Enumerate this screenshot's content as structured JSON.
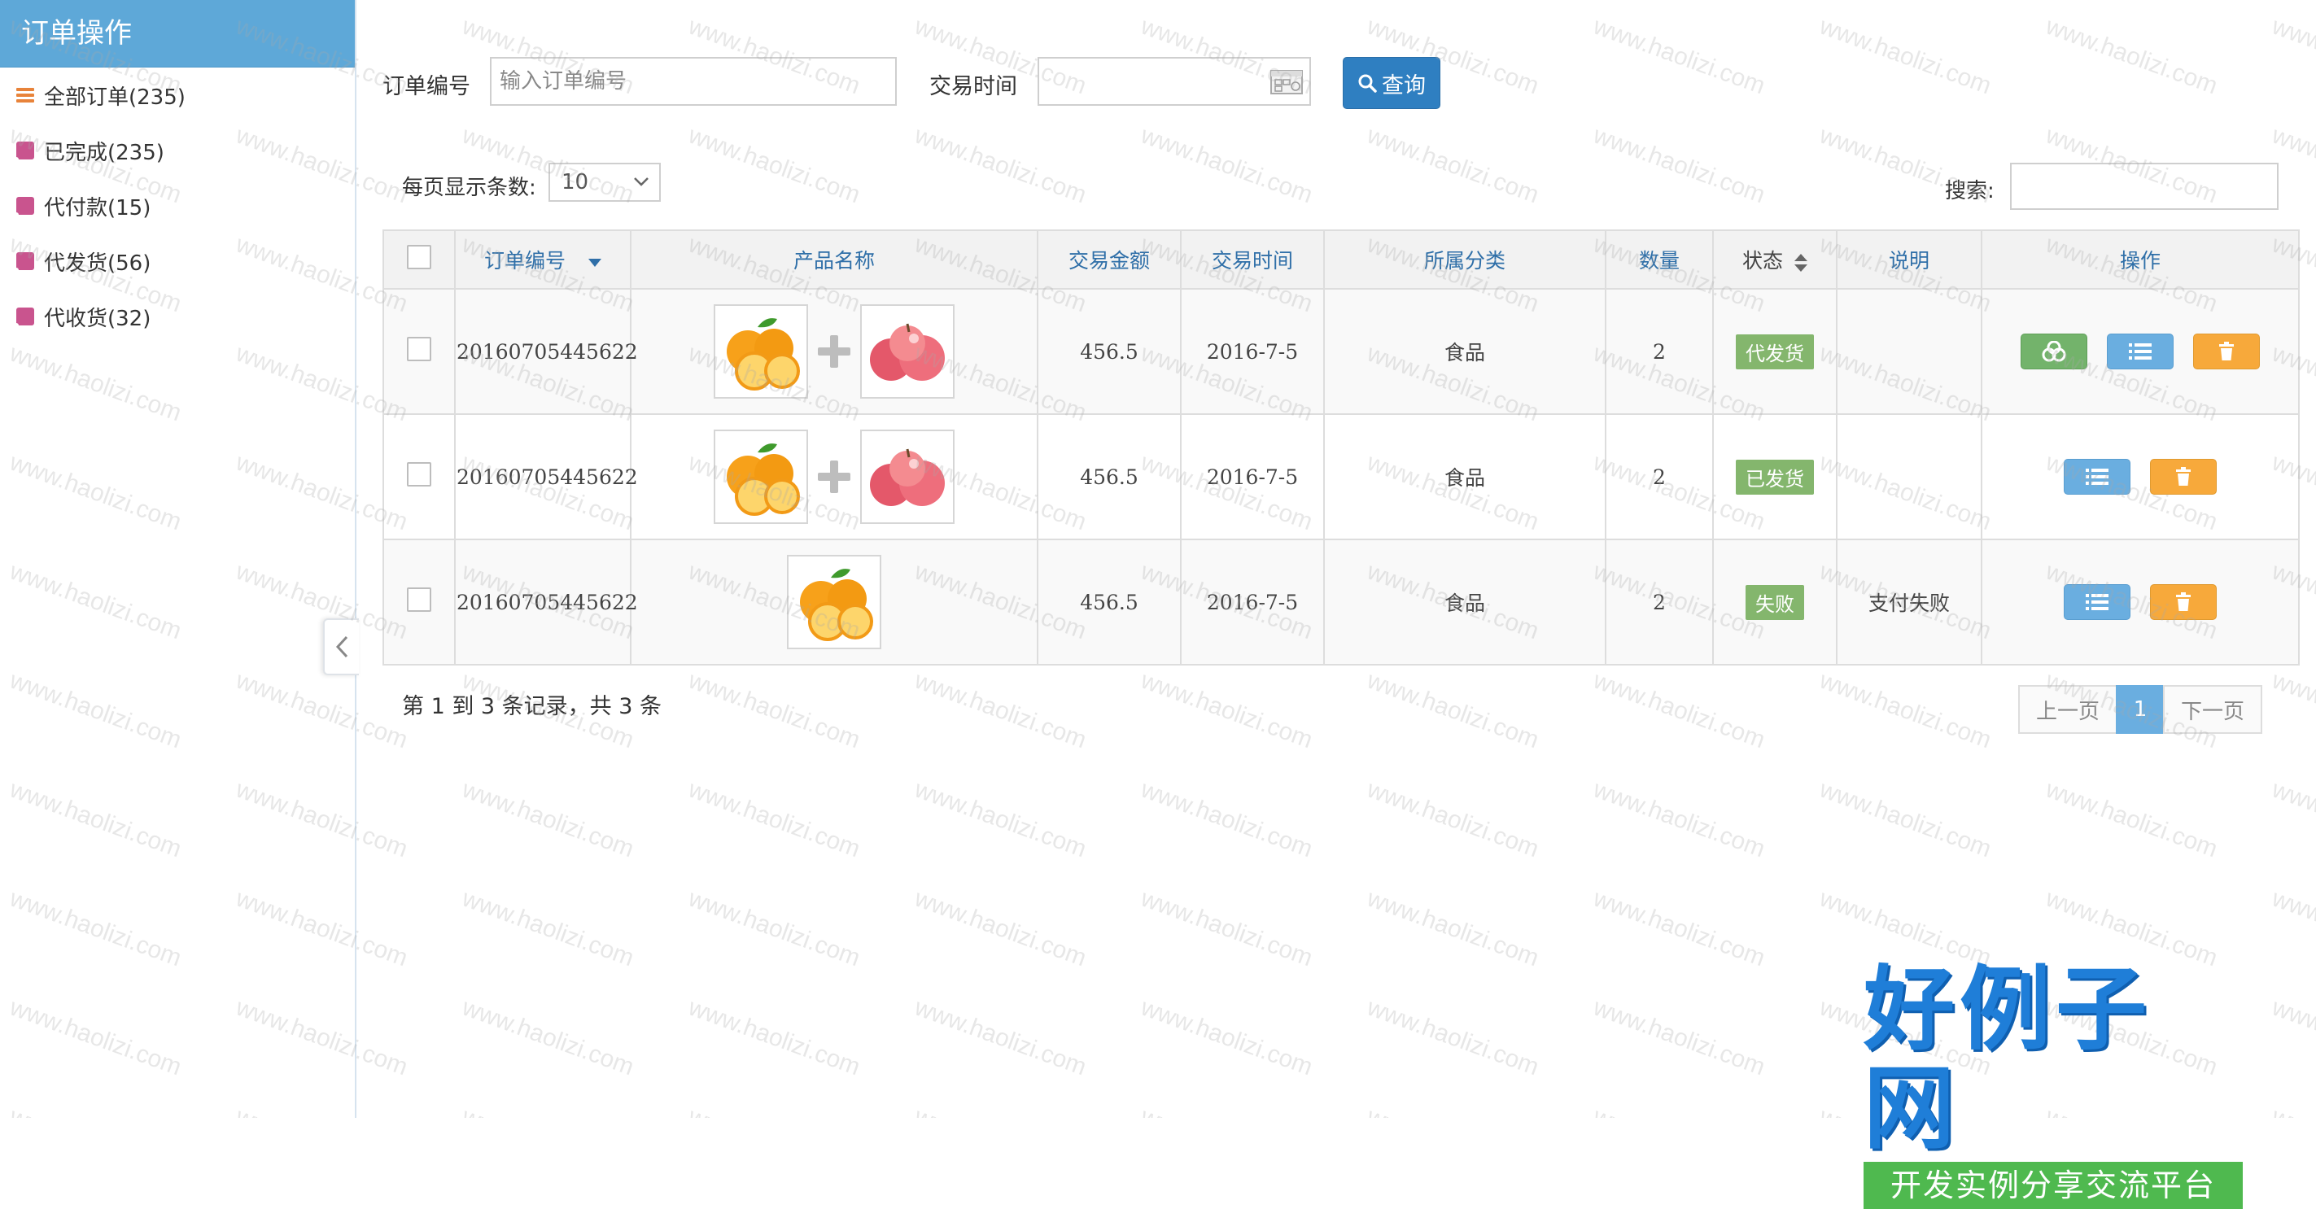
{
  "sidebar": {
    "title": "订单操作",
    "items": [
      {
        "label": "全部订单(235)",
        "icon": "menu-icon",
        "color": "#e8833a"
      },
      {
        "label": "已完成(235)",
        "icon": "tag-icon",
        "color": "#c9548e"
      },
      {
        "label": "代付款(15)",
        "icon": "tag-icon",
        "color": "#c9548e"
      },
      {
        "label": "代发货(56)",
        "icon": "tag-icon",
        "color": "#c9548e"
      },
      {
        "label": "代收货(32)",
        "icon": "tag-icon",
        "color": "#c9548e"
      }
    ]
  },
  "filters": {
    "order_no_label": "订单编号",
    "order_no_placeholder": "输入订单编号",
    "order_no_value": "",
    "trade_time_label": "交易时间",
    "trade_time_value": "",
    "query_label": "查询"
  },
  "list_controls": {
    "page_size_label": "每页显示条数:",
    "page_size_value": "10",
    "search_label": "搜索:",
    "search_value": ""
  },
  "table": {
    "columns": [
      "订单编号",
      "产品名称",
      "交易金额",
      "交易时间",
      "所属分类",
      "数量",
      "状态",
      "说明",
      "操作"
    ],
    "rows": [
      {
        "order_no": "20160705445622",
        "products": [
          "orange",
          "apple"
        ],
        "amount": "456.5",
        "date": "2016-7-5",
        "category": "食品",
        "qty": "2",
        "status": "代发货",
        "status_color": "#84b66d",
        "note": "",
        "actions": [
          "detail-view",
          "list",
          "delete"
        ]
      },
      {
        "order_no": "20160705445622",
        "products": [
          "orange",
          "apple"
        ],
        "amount": "456.5",
        "date": "2016-7-5",
        "category": "食品",
        "qty": "2",
        "status": "已发货",
        "status_color": "#84b66d",
        "note": "",
        "actions": [
          "list",
          "delete"
        ]
      },
      {
        "order_no": "20160705445622",
        "products": [
          "orange"
        ],
        "amount": "456.5",
        "date": "2016-7-5",
        "category": "食品",
        "qty": "2",
        "status": "失败",
        "status_color": "#84b66d",
        "note": "支付失败",
        "actions": [
          "list",
          "delete"
        ]
      }
    ]
  },
  "footer": {
    "record_info": "第 1 到 3 条记录，共 3 条",
    "prev_label": "上一页",
    "current_page": "1",
    "next_label": "下一页"
  },
  "watermark": {
    "text": "www.haolizi.com",
    "logo_main": "好例子网",
    "logo_sub": "开发实例分享交流平台"
  },
  "colors": {
    "sidebar_header": "#5ea8d8",
    "primary_button": "#2f7fc1",
    "action_blue": "#6aaee0",
    "action_orange": "#f7a93b",
    "action_green": "#73b36b",
    "header_text": "#2f6fa8"
  }
}
